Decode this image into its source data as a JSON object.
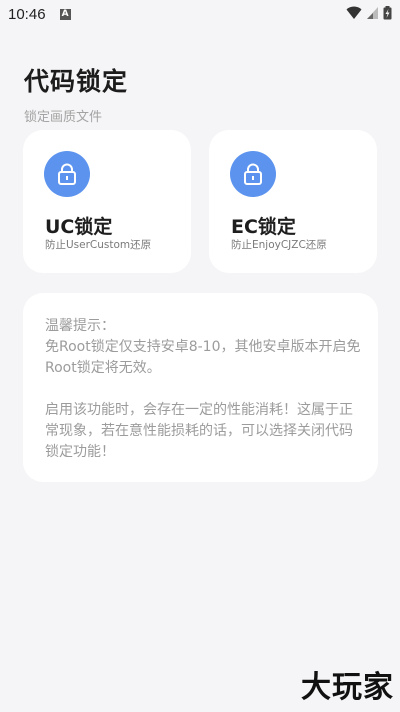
{
  "status_bar": {
    "time": "10:46",
    "notification_letter": "A"
  },
  "header": {
    "title": "代码锁定",
    "subtitle": "锁定画质文件"
  },
  "cards": [
    {
      "title": "UC锁定",
      "description": "防止UserCustom还原",
      "icon": "lock-icon",
      "icon_color": "#5b93ee"
    },
    {
      "title": "EC锁定",
      "description": "防止EnjoyCJZC还原",
      "icon": "lock-icon",
      "icon_color": "#5b93ee"
    }
  ],
  "tips": {
    "heading": "温馨提示：",
    "paragraph1": "免Root锁定仅支持安卓8-10，其他安卓版本开启免Root锁定将无效。",
    "paragraph2": "启用该功能时，会存在一定的性能消耗！这属于正常现象，若在意性能损耗的话，可以选择关闭代码锁定功能！"
  },
  "watermark": "大玩家"
}
